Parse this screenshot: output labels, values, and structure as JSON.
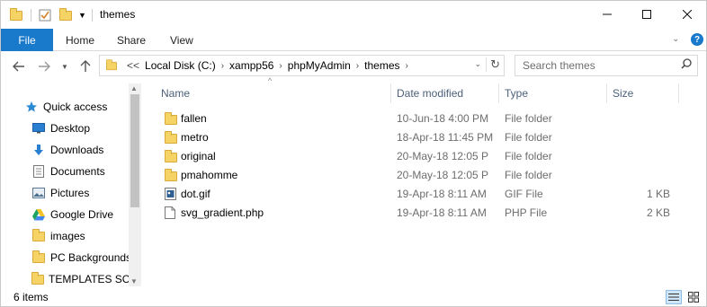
{
  "window": {
    "title": "themes"
  },
  "ribbon": {
    "tabs": [
      "File",
      "Home",
      "Share",
      "View"
    ],
    "help": "?"
  },
  "address": {
    "overflow": "<<",
    "crumbs": [
      "Local Disk (C:)",
      "xampp56",
      "phpMyAdmin",
      "themes"
    ]
  },
  "search": {
    "placeholder": "Search themes"
  },
  "nav": {
    "items": [
      {
        "label": "Quick access",
        "icon": "star-icon",
        "pinned": false
      },
      {
        "label": "Desktop",
        "icon": "desktop-icon",
        "pinned": true
      },
      {
        "label": "Downloads",
        "icon": "download-arrow-icon",
        "pinned": true
      },
      {
        "label": "Documents",
        "icon": "documents-icon",
        "pinned": true
      },
      {
        "label": "Pictures",
        "icon": "pictures-icon",
        "pinned": true
      },
      {
        "label": "Google Drive",
        "icon": "google-drive-icon",
        "pinned": true
      },
      {
        "label": "images",
        "icon": "folder-icon",
        "pinned": false
      },
      {
        "label": "PC Backgrounds",
        "icon": "folder-icon",
        "pinned": false
      },
      {
        "label": "TEMPLATES SCR",
        "icon": "folder-icon",
        "pinned": false
      }
    ]
  },
  "columns": {
    "name": "Name",
    "date": "Date modified",
    "type": "Type",
    "size": "Size"
  },
  "files": [
    {
      "name": "fallen",
      "date": "10-Jun-18 4:00 PM",
      "type": "File folder",
      "size": "",
      "icon": "folder-icon"
    },
    {
      "name": "metro",
      "date": "18-Apr-18 11:45 PM",
      "type": "File folder",
      "size": "",
      "icon": "folder-icon"
    },
    {
      "name": "original",
      "date": "20-May-18 12:05 P",
      "type": "File folder",
      "size": "",
      "icon": "folder-icon"
    },
    {
      "name": "pmahomme",
      "date": "20-May-18 12:05 P",
      "type": "File folder",
      "size": "",
      "icon": "folder-icon"
    },
    {
      "name": "dot.gif",
      "date": "19-Apr-18 8:11 AM",
      "type": "GIF File",
      "size": "1 KB",
      "icon": "image-file-icon"
    },
    {
      "name": "svg_gradient.php",
      "date": "19-Apr-18 8:11 AM",
      "type": "PHP File",
      "size": "2 KB",
      "icon": "file-icon"
    }
  ],
  "status": {
    "count": "6 items"
  },
  "colors": {
    "accent": "#1979ca",
    "folder": "#f6d365",
    "header_text": "#4c607a"
  }
}
